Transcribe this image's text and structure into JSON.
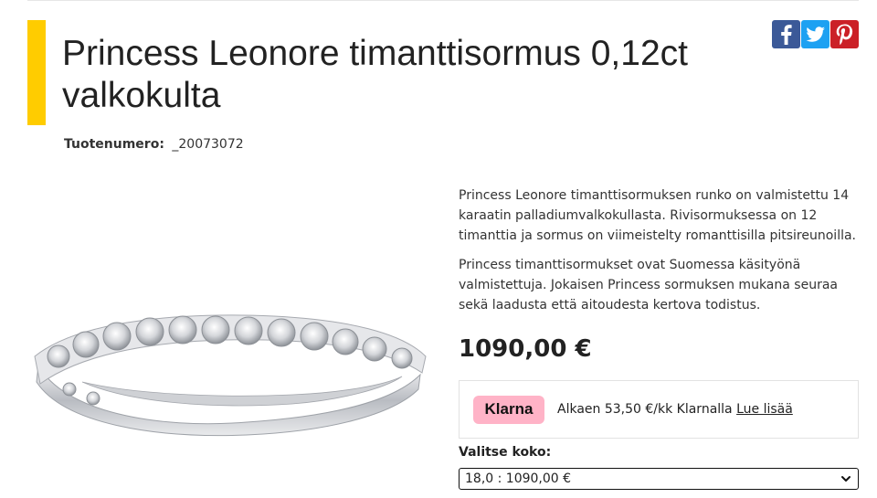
{
  "product": {
    "title": "Princess Leonore timanttisormus 0,12ct valkokulta",
    "number_label": "Tuotenumero:",
    "number_value": "_20073072"
  },
  "share": {
    "icons": [
      "facebook-icon",
      "twitter-icon",
      "pinterest-icon"
    ]
  },
  "description": {
    "p1": "Princess Leonore timanttisormuksen runko on valmistettu 14 karaatin palladiumvalkokullasta. Rivisormuksessa on 12 timanttia ja sormus on viimeistelty romanttisilla pitsireunoilla.",
    "p2": "Princess timanttisormukset ovat Suomessa käsityönä valmistettuja. Jokaisen Princess sormuksen mukana seuraa sekä laadusta että aitoudesta kertova todistus."
  },
  "price": "1090,00 €",
  "klarna": {
    "badge": "Klarna",
    "text": "Alkaen 53,50 €/kk Klarnalla",
    "link": "Lue lisää"
  },
  "size": {
    "label": "Valitse koko:",
    "selected": "18,0 : 1090,00 €"
  },
  "colors": {
    "accent": "#ffcc00",
    "klarna_pink": "#ffb3c7",
    "facebook": "#3b5998",
    "twitter": "#1da1f2",
    "pinterest": "#cb2027"
  }
}
